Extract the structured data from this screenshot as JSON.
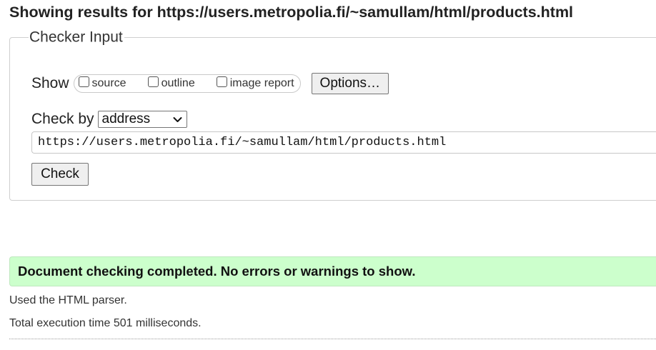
{
  "heading": "Showing results for https://users.metropolia.fi/~samullam/html/products.html",
  "checker": {
    "legend": "Checker Input",
    "show_label": "Show",
    "show_options": [
      {
        "label": "source",
        "checked": false
      },
      {
        "label": "outline",
        "checked": false
      },
      {
        "label": "image report",
        "checked": false
      }
    ],
    "options_button": "Options…",
    "check_by_label": "Check by",
    "check_by_value": "address",
    "url_value": "https://users.metropolia.fi/~samullam/html/products.html",
    "check_button": "Check"
  },
  "result": {
    "success_message": "Document checking completed. No errors or warnings to show.",
    "success_color": "#ccffcc",
    "parser_note": "Used the HTML parser.",
    "execution_time": "Total execution time 501 milliseconds."
  }
}
